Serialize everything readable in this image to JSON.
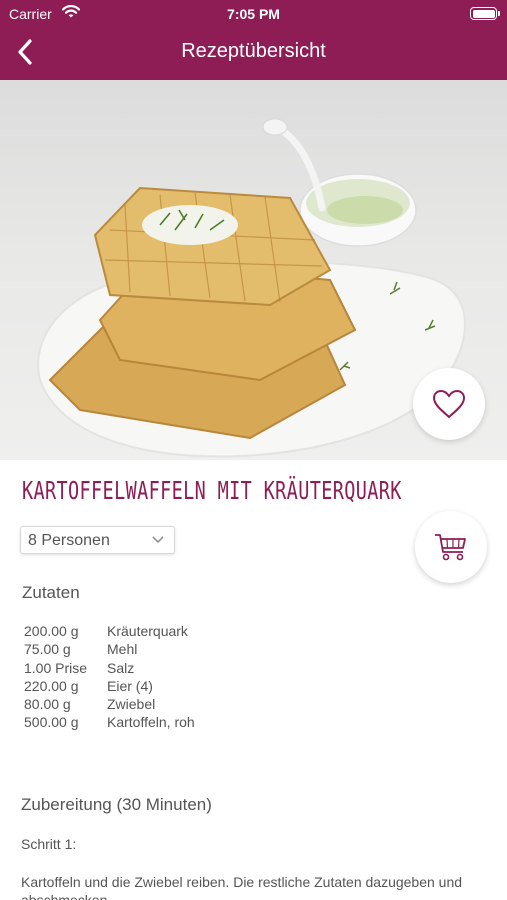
{
  "status_bar": {
    "carrier": "Carrier",
    "time": "7:05 PM"
  },
  "nav": {
    "title": "Rezeptübersicht",
    "back_icon": "chevron-left-icon"
  },
  "recipe": {
    "title": "KARTOFFELWAFFELN MIT KRÄUTERQUARK",
    "persons_select": {
      "value": "8 Personen"
    },
    "favorite_icon": "heart-icon",
    "cart_icon": "shopping-cart-icon"
  },
  "ingredients": {
    "heading": "Zutaten",
    "items": [
      {
        "amount": "200.00 g",
        "name": "Kräuterquark"
      },
      {
        "amount": "75.00 g",
        "name": "Mehl"
      },
      {
        "amount": "1.00 Prise",
        "name": "Salz"
      },
      {
        "amount": "220.00 g",
        "name": "Eier (4)"
      },
      {
        "amount": "80.00 g",
        "name": "Zwiebel"
      },
      {
        "amount": "500.00 g",
        "name": "Kartoffeln, roh"
      }
    ]
  },
  "preparation": {
    "heading": "Zubereitung (30 Minuten)",
    "step_label": "Schritt 1:",
    "step_text": "Kartoffeln und die Zwiebel reiben. Die restliche Zutaten dazugeben und abschmecken."
  },
  "colors": {
    "brand": "#8e1d56",
    "text": "#555555"
  }
}
